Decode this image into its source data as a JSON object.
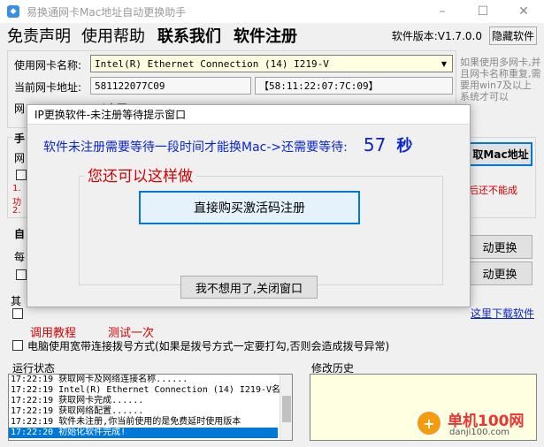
{
  "window": {
    "title": "易换通网卡Mac地址自动更换助手",
    "minimize": "–",
    "maximize": "☐",
    "close": "✕"
  },
  "menu": {
    "items": [
      "免责声明",
      "使用帮助",
      "联系我们",
      "软件注册"
    ],
    "version_label": "软件版本:V1.7.0.0",
    "hide_label": "隐藏软件"
  },
  "main": {
    "nic_name_label": "使用网卡名称:",
    "nic_name_value": "Intel(R) Ethernet Connection (14) I219-V",
    "mac_label": "当前网卡地址:",
    "mac_value": "581122077C09",
    "mac_formatted": "【58:11:22:07:7C:09】",
    "network_label_partial": "网",
    "network_value_partial": "以太网",
    "side_note": "如果使用多网卡,并且网卡名称重复,需要用win7及以上系统才可以",
    "section_manual_partial": "手",
    "net_partial": "网",
    "get_mac_button_partial": "取Mac地址",
    "red_line1_partial": "1.",
    "red_line2_partial": "功",
    "red_line3_partial": "2.",
    "red_right_partial": "后还不能成",
    "section_auto_partial": "自",
    "every_partial": "每",
    "auto_change_button1_partial": "动更换",
    "auto_change_button2_partial": "动更换",
    "section_other_partial": "其",
    "download_link_partial": "这里下载软件",
    "debug_link": "调用教程",
    "test_link": "测试一次",
    "broadband_checkbox_label": "电脑使用宽带连接拨号方式(如果是拨号方式一定要打勾,否则会造成拨号异常)"
  },
  "status": {
    "label": "运行状态",
    "lines": [
      "17:22:19 获取网卡及网络连接名称......",
      "17:22:19 Intel(R) Ethernet Connection (14) I219-V名",
      "17:22:19 获取网卡完成......",
      "17:22:19 获取网络配置......",
      "17:22:19 软件未注册,你当前使用的是免费延时使用版本",
      "17:22:20 初始化软件完成!"
    ]
  },
  "history": {
    "label": "修改历史"
  },
  "watermark": {
    "text1": "单机100网",
    "text2": "danji100.com"
  },
  "dialog": {
    "title": "IP更换软件-未注册等待提示窗口",
    "wait_text": "软件未注册需要等待一段时间才能换Mac->还需要等待:",
    "wait_seconds": "57",
    "wait_unit": "秒",
    "group_label": "您还可以这样做",
    "buy_button": "直接购买激活码注册",
    "close_button": "我不想用了,关闭窗口"
  },
  "colors": {
    "accent_blue": "#0b26c9",
    "red": "#d40000",
    "selected_row": "#0078d7",
    "history_bg": "#ffffe1"
  }
}
